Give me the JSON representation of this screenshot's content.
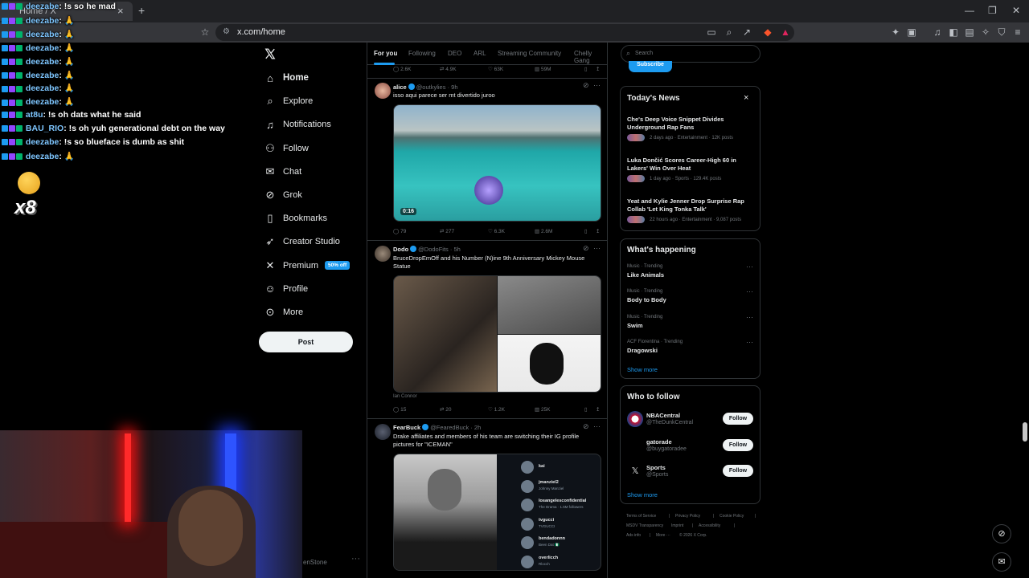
{
  "browser": {
    "tab_title": "Home / X",
    "tab_close": "×",
    "new_tab": "+",
    "url": "x.com/home",
    "window_controls": [
      "—",
      "❐",
      "✕"
    ]
  },
  "chat": [
    {
      "user": "deezabe",
      "msg": ": !s so he mad"
    },
    {
      "user": "deezabe",
      "msg": ": 🙏"
    },
    {
      "user": "deezabe",
      "msg": ": 🙏"
    },
    {
      "user": "deezabe",
      "msg": ": 🙏"
    },
    {
      "user": "deezabe",
      "msg": ": 🙏"
    },
    {
      "user": "deezabe",
      "msg": ": 🙏"
    },
    {
      "user": "deezabe",
      "msg": ": 🙏"
    },
    {
      "user": "deezabe",
      "msg": ": 🙏"
    },
    {
      "user": "at8u",
      "msg": ": !s oh dats what he said"
    },
    {
      "user": "BAU_RIO",
      "msg": ": !s oh yuh generational debt on the way"
    },
    {
      "user": "deezabe",
      "msg": ": !s so blueface is dumb as shit"
    },
    {
      "user": "deezabe",
      "msg": ": 🙏"
    }
  ],
  "chat_combo": "x8",
  "nav": {
    "items": [
      {
        "label": "Home",
        "icon": "home-icon"
      },
      {
        "label": "Explore",
        "icon": "search-icon"
      },
      {
        "label": "Notifications",
        "icon": "bell-icon"
      },
      {
        "label": "Follow",
        "icon": "add-user-icon"
      },
      {
        "label": "Chat",
        "icon": "mail-icon"
      },
      {
        "label": "Grok",
        "icon": "grok-icon"
      },
      {
        "label": "Bookmarks",
        "icon": "bookmark-icon"
      },
      {
        "label": "Creator Studio",
        "icon": "rocket-icon"
      },
      {
        "label": "Premium",
        "icon": "x-logo-icon"
      },
      {
        "label": "Profile",
        "icon": "person-icon"
      },
      {
        "label": "More",
        "icon": "more-circle-icon"
      }
    ],
    "premium_badge": "50% off",
    "post_button": "Post",
    "account_fragment": "enStone",
    "more_dots": "···"
  },
  "feed": {
    "tabs": [
      "For you",
      "Following",
      "DEO",
      "ARL",
      "Streaming Community",
      "Chelly Gang"
    ],
    "top_actions": {
      "replies": "2.6K",
      "reposts": "4.9K",
      "likes": "63K",
      "views": "59M"
    },
    "posts": [
      {
        "name": "alice",
        "handle": "@outkylies · 9h",
        "text": "isso aqui parece ser mt divertido juroo",
        "video_time": "0:16",
        "actions": {
          "replies": "79",
          "reposts": "277",
          "likes": "6.3K",
          "views": "2.6M"
        }
      },
      {
        "name": "Dodo",
        "handle": "@DodoFits · 5h",
        "text": "BruceDropEmOff and his Number (N)ine 9th Anniversary Mickey Mouse Statue",
        "caption": "Ian Connor",
        "actions": {
          "replies": "15",
          "reposts": "20",
          "likes": "1.2K",
          "views": "25K"
        }
      },
      {
        "name": "FearBuck",
        "handle": "@FearedBuck · 2h",
        "text": "Drake affiliates and members of his team are switching their IG profile pictures for \"ICEMAN\"",
        "list": [
          {
            "name": "kai",
            "sub": ""
          },
          {
            "name": "jmanziel2",
            "sub": "Johnny Manziel"
          },
          {
            "name": "losangelesconfidential",
            "sub": "The Drama · 1.5M followers"
          },
          {
            "name": "tvgucci",
            "sub": "TVGUCCI"
          },
          {
            "name": "bendadonnn",
            "sub": "Been Dat 🇳🇬"
          },
          {
            "name": "overlicch",
            "sub": "Rlocch"
          }
        ]
      }
    ]
  },
  "right": {
    "search_placeholder": "Search",
    "subscribe": "Subscribe",
    "todays_news": {
      "title": "Today's News",
      "close": "×",
      "items": [
        {
          "headline": "Che's Deep Voice Snippet Divides Underground Rap Fans",
          "meta": "2 days ago · Entertainment · 12K posts"
        },
        {
          "headline": "Luka Dončić Scores Career-High 60 in Lakers' Win Over Heat",
          "meta": "1 day ago · Sports · 129.4K posts"
        },
        {
          "headline": "Yeat and Kylie Jenner Drop Surprise Rap Collab 'Let King Tonka Talk'",
          "meta": "22 hours ago · Entertainment · 9,087 posts"
        }
      ]
    },
    "whats_happening": {
      "title": "What's happening",
      "items": [
        {
          "meta": "Music · Trending",
          "name": "Like Animals"
        },
        {
          "meta": "Music · Trending",
          "name": "Body to Body"
        },
        {
          "meta": "Music · Trending",
          "name": "Swim"
        },
        {
          "meta": "ACF Fiorentina · Trending",
          "name": "Dragowski"
        }
      ],
      "show_more": "Show more"
    },
    "who_to_follow": {
      "title": "Who to follow",
      "items": [
        {
          "name": "NBACentral",
          "handle": "@TheDunkCentral",
          "button": "Follow"
        },
        {
          "name": "gatorade",
          "handle": "@buygatoradee",
          "button": "Follow"
        },
        {
          "name": "Sports",
          "handle": "@Sports",
          "button": "Follow"
        }
      ],
      "show_more": "Show more"
    },
    "footer": [
      "Terms of Service",
      "|",
      "Privacy Policy",
      "|",
      "Cookie Policy",
      "|",
      "MSDV Transparency",
      "Imprint",
      "|",
      "Accessibility",
      "|",
      "Ads info",
      "|",
      "More ···",
      "© 2026 X Corp."
    ]
  },
  "colors": {
    "accent": "#1d9bf0",
    "bg": "#000000",
    "border": "#2f3336",
    "muted": "#71767b"
  }
}
